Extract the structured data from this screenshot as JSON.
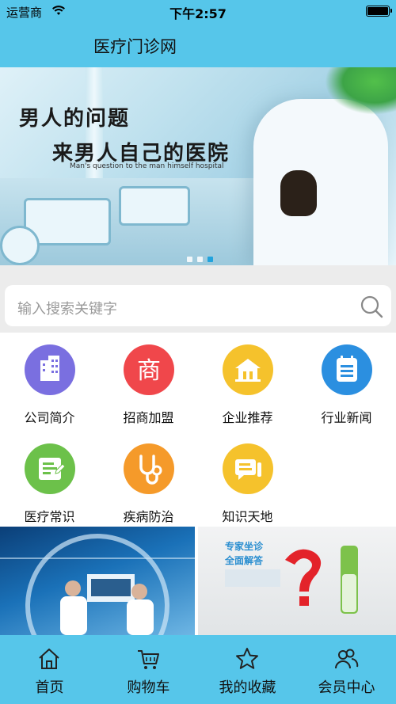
{
  "status_bar": {
    "carrier": "运营商",
    "time": "下午2:57"
  },
  "header": {
    "title": "医疗门诊网"
  },
  "banner": {
    "line1": "男人的问题",
    "line2": "来男人自己的医院",
    "subtitle": "Man's question to the man himself hospital",
    "active_slide": 2,
    "slide_count": 3
  },
  "search": {
    "placeholder": "输入搜索关键字"
  },
  "categories": [
    {
      "label": "公司简介",
      "icon": "building-icon",
      "color": "#7a6fe0"
    },
    {
      "label": "招商加盟",
      "icon": "shang-icon",
      "color": "#f0474b"
    },
    {
      "label": "企业推荐",
      "icon": "enterprise-icon",
      "color": "#f5c22c"
    },
    {
      "label": "行业新闻",
      "icon": "news-icon",
      "color": "#2b8fe0"
    },
    {
      "label": "医疗常识",
      "icon": "document-icon",
      "color": "#6cc14a"
    },
    {
      "label": "疾病防治",
      "icon": "stethoscope-icon",
      "color": "#f59a2a"
    },
    {
      "label": "知识天地",
      "icon": "chat-icon",
      "color": "#f5c22c"
    }
  ],
  "promos": {
    "right_line1": "专家坐诊",
    "right_line2": "全面解答"
  },
  "tabs": [
    {
      "label": "首页",
      "icon": "home-icon"
    },
    {
      "label": "购物车",
      "icon": "cart-icon"
    },
    {
      "label": "我的收藏",
      "icon": "star-icon"
    },
    {
      "label": "会员中心",
      "icon": "members-icon"
    }
  ],
  "colors": {
    "primary": "#56c6ea",
    "accent_dot": "#21a3dd"
  }
}
